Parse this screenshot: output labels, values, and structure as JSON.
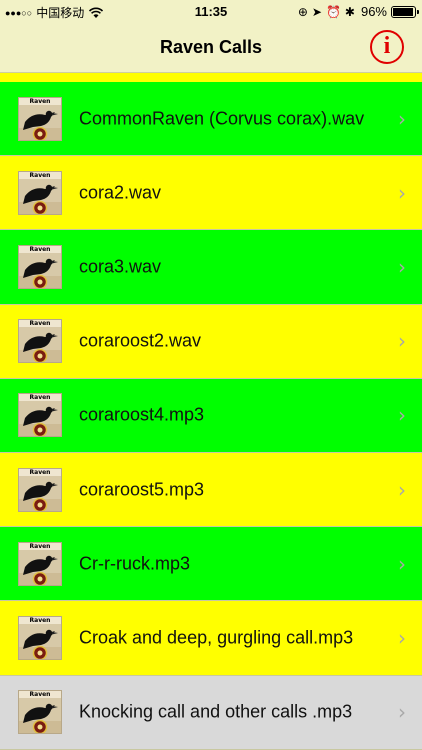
{
  "status_bar": {
    "signal": "●●●○○",
    "carrier": "中国移动",
    "time": "11:35",
    "battery": "96%",
    "icons": [
      "wifi-icon",
      "orientation-lock-icon",
      "location-icon",
      "alarm-icon",
      "bluetooth-icon",
      "battery-icon"
    ]
  },
  "nav": {
    "title": "Raven Calls",
    "info_glyph": "i"
  },
  "colors": {
    "green": "#00ff00",
    "yellow": "#ffff00",
    "gray": "#d9d9d9",
    "info_red": "#e00000"
  },
  "list": {
    "items": [
      {
        "label": "CommonRaven (Corvus corax).wav",
        "thumb_label": "Raven",
        "color": "green"
      },
      {
        "label": "cora2.wav",
        "thumb_label": "Raven",
        "color": "yellow"
      },
      {
        "label": "cora3.wav",
        "thumb_label": "Raven",
        "color": "green"
      },
      {
        "label": "coraroost2.wav",
        "thumb_label": "Raven",
        "color": "yellow"
      },
      {
        "label": "coraroost4.mp3",
        "thumb_label": "Raven",
        "color": "green"
      },
      {
        "label": "coraroost5.mp3",
        "thumb_label": "Raven",
        "color": "yellow"
      },
      {
        "label": "Cr-r-ruck.mp3",
        "thumb_label": "Raven",
        "color": "green"
      },
      {
        "label": "Croak and deep, gurgling call.mp3",
        "thumb_label": "Raven",
        "color": "yellow"
      },
      {
        "label": "Knocking call and other calls .mp3",
        "thumb_label": "Raven",
        "color": "gray"
      }
    ],
    "chevron": "›"
  }
}
